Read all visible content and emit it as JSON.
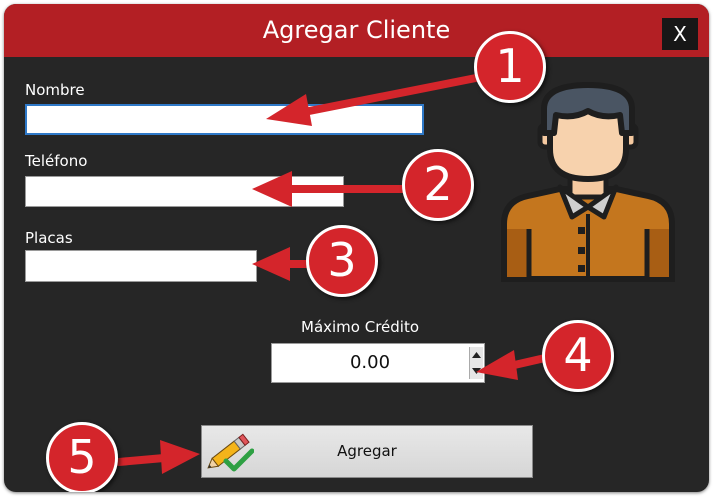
{
  "window": {
    "title": "Agregar Cliente",
    "close_label": "X"
  },
  "form": {
    "nombre_label": "Nombre",
    "nombre_value": "",
    "telefono_label": "Teléfono",
    "telefono_value": "",
    "placas_label": "Placas",
    "placas_value": "",
    "credito_label": "Máximo Crédito",
    "credito_value": "0.00"
  },
  "actions": {
    "agregar_label": "Agregar"
  },
  "callouts": [
    "1",
    "2",
    "3",
    "4",
    "5"
  ],
  "colors": {
    "titlebar": "#b31f24",
    "background": "#262626",
    "callout": "#d4252b",
    "focus": "#2f79c8"
  },
  "icons": [
    "close-icon",
    "user-avatar-icon",
    "pencil-check-icon",
    "spin-up-icon",
    "spin-down-icon",
    "arrow-icon"
  ]
}
